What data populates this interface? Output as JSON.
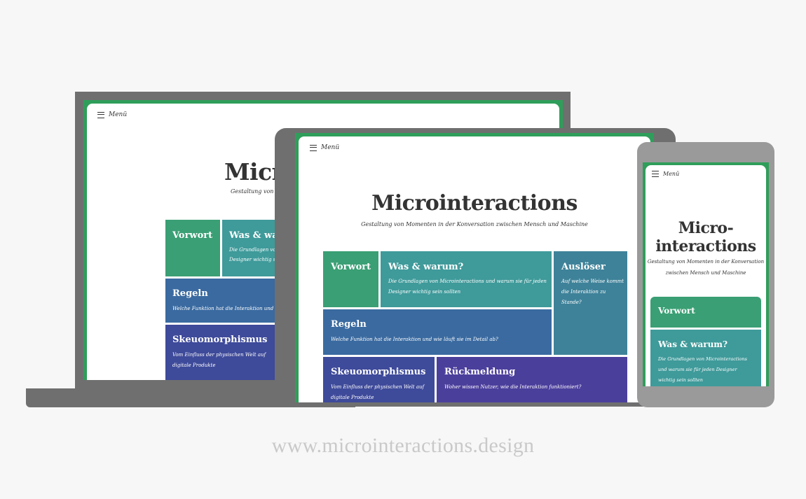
{
  "site": {
    "menu_label": "Menü",
    "title": "Microinteractions",
    "title_phone_line1": "Micro-",
    "title_phone_line2": "interactions",
    "subtitle": "Gestaltung von Momenten in der Konversation zwischen Mensch und Maschine",
    "subtitle_phone_line1": "Gestaltung von Momenten in der Konversation",
    "subtitle_phone_line2": "zwischen Mensch und Maschine"
  },
  "laptop": {
    "title_visible": "Micr",
    "subtitle_visible": "Gestaltung von Mo",
    "tile_waswarum_visible": "Was & wa",
    "tile_waswarum_desc_l1": "Die Grundlagen vo",
    "tile_waswarum_desc_l2": "Designer wichtig se",
    "tile_regeln_desc_visible": "Welche Funktion hat die Interaktion und wi"
  },
  "tiles": {
    "vorwort": {
      "title": "Vorwort"
    },
    "waswarum": {
      "title": "Was & warum?",
      "desc": "Die Grundlagen von Microinteractions und warum sie für jeden Designer wichtig sein sollten",
      "desc_l1": "Die Grundlagen von Microinteractions und warum sie für jeden",
      "desc_l2": "Designer wichtig sein sollten"
    },
    "ausloeser": {
      "title": "Auslöser",
      "desc_l1": "Auf welche Weise kommt",
      "desc_l2": "die Interaktion zu",
      "desc_l3": "Stande?"
    },
    "regeln": {
      "title": "Regeln",
      "desc": "Welche Funktion hat die Interaktion und wie läuft sie im Detail ab?"
    },
    "skeuo": {
      "title": "Skeuomorphismus",
      "desc_l1": "Vom Einfluss der physischen Welt auf",
      "desc_l2": "digitale Produkte"
    },
    "rueckmeldung": {
      "title": "Rückmeldung",
      "desc": "Woher wissen Nutzer, wie die Interaktion funktioniert?"
    }
  },
  "phone": {
    "waswarum_desc_l1": "Die Grundlagen von Microinteractions",
    "waswarum_desc_l2": "und warum sie für jeden Designer",
    "waswarum_desc_l3": "wichtig sein sollten"
  },
  "footer": {
    "url": "www.microinteractions.design"
  },
  "colors": {
    "background": "#f7f7f7",
    "device_dark": "#6f6f6f",
    "device_phone": "#9a9a9a",
    "screen_accent": "#2f9e5a",
    "tile_green": "#3a9f74",
    "tile_teal": "#3f9a9a",
    "tile_blue": "#3a6aa0",
    "tile_indigo": "#3e4a9a",
    "tile_purple": "#4b3f9c",
    "url_gray": "#c9c9c9"
  }
}
